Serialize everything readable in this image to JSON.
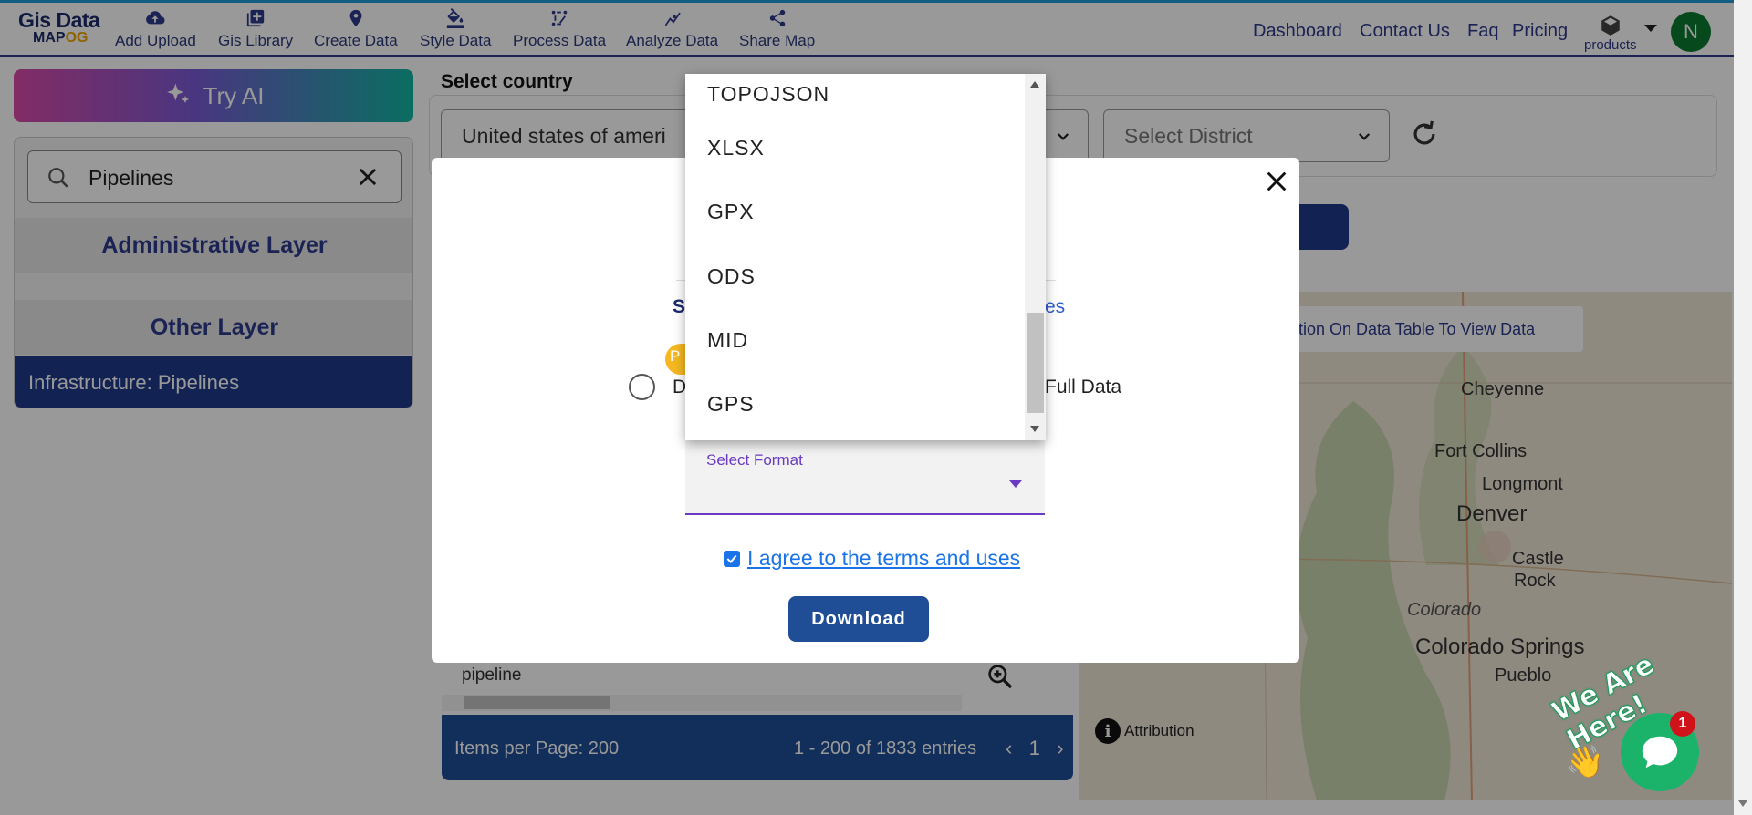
{
  "logo": {
    "line1": "Gis Data",
    "line2_a": "MAP",
    "line2_b": "OG"
  },
  "nav": [
    {
      "label": "Add Upload",
      "icon": "cloud-upload-icon"
    },
    {
      "label": "Gis Library",
      "icon": "library-add-icon"
    },
    {
      "label": "Create Data",
      "icon": "map-pin-icon"
    },
    {
      "label": "Style Data",
      "icon": "paint-bucket-icon"
    },
    {
      "label": "Process Data",
      "icon": "process-icon"
    },
    {
      "label": "Analyze Data",
      "icon": "analyze-icon"
    },
    {
      "label": "Share Map",
      "icon": "share-icon"
    }
  ],
  "top_links": {
    "dashboard": "Dashboard",
    "contact": "Contact Us",
    "faq": "Faq",
    "pricing": "Pricing",
    "products": "products"
  },
  "user": {
    "initial": "N"
  },
  "sidebar": {
    "try_ai": "Try AI",
    "search_value": "Pipelines",
    "administrative_layer": "Administrative Layer",
    "other_layer": "Other Layer",
    "selected_layer": "Infrastructure: Pipelines"
  },
  "main": {
    "select_country_label": "Select country",
    "country_value": "United states of ameri",
    "district_placeholder": "Select District",
    "map_note": "ction On Data Table To View Data",
    "attribution": "Attribution",
    "cities": {
      "cheyenne": "Cheyenne",
      "fort_collins": "Fort Collins",
      "longmont": "Longmont",
      "denver": "Denver",
      "castle": "Castle",
      "rock": "Rock",
      "colorado": "Colorado",
      "colorado_springs": "Colorado Springs",
      "pueblo": "Pueblo"
    },
    "table_cell": "pipeline",
    "items_per_page": "Items per Page: 200",
    "range": "1 - 200  of  1833 entries",
    "page": "1"
  },
  "modal": {
    "partial_s": "S",
    "partial_es": "es",
    "partial_d": "D",
    "partial_p": "P",
    "full_data": "Full Data",
    "format_label": "Select Format",
    "agree_text": "I agree to the terms and uses",
    "download": "Download"
  },
  "format_options": [
    "TOPOJSON",
    "XLSX",
    "GPX",
    "ODS",
    "MID",
    "GPS"
  ],
  "chat": {
    "badge": "1",
    "tagline": "We Are Here!"
  },
  "colors": {
    "brand": "#1f3a8a",
    "accent": "#6a3bc2",
    "link": "#1a73e8",
    "chat": "#1bb36a"
  }
}
